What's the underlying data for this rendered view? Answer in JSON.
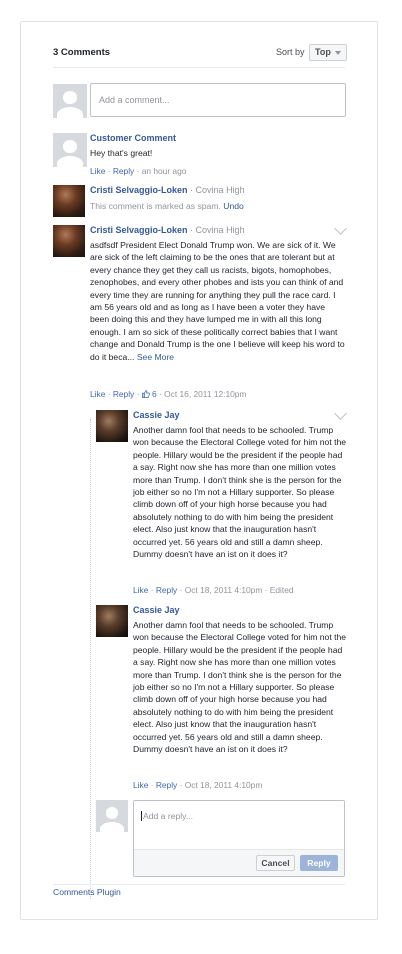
{
  "header": {
    "count_label": "3 Comments",
    "sort_label": "Sort by",
    "sort_value": "Top"
  },
  "composer": {
    "placeholder": "Add a comment..."
  },
  "comments": [
    {
      "author": "Customer Comment",
      "text": "Hey that's great!",
      "like": "Like",
      "reply": "Reply",
      "time": "an hour ago"
    },
    {
      "author": "Cristi Selvaggio-Loken",
      "school": "Covina High",
      "spam_text": "This comment is marked as spam.",
      "undo": "Undo"
    },
    {
      "author": "Cristi Selvaggio-Loken",
      "school": "Covina High",
      "text": "asdfsdf President Elect Donald Trump won. We are sick of it. We are sick of the left claiming to be the ones that are tolerant but at every chance they get they call us racists, bigots, homophobes, zenophobes, and every other phobes and ists you can think of and every time they are running for anything they pull the race card. I am 56 years old and as long as I have been a voter they have been doing this and they have lumped me in with all this long enough. I am so sick of these politically correct babies that I want change and Donald Trump is the one I believe will keep his word to do it beca...",
      "see_more": "See More",
      "like": "Like",
      "reply": "Reply",
      "likes": "6",
      "time": "Oct 16, 2011 12:10pm"
    }
  ],
  "replies": [
    {
      "author": "Cassie Jay",
      "text": "Another damn fool that needs to be schooled. Trump won because the Electoral College voted for him not the people. Hillary would be the president if the people had a say. Right now she has more than one million votes more than Trump. I don't think she is the person for the job either so no I'm not a Hillary supporter. So please climb down off of your high horse because you had absolutely nothing to do with him being the president elect. Also just know that the inauguration hasn't occurred yet. 56 years old and still a damn sheep. Dummy doesn't have an ist on it does it?",
      "like": "Like",
      "reply": "Reply",
      "time": "Oct 18, 2011 4:10pm",
      "edited": "Edited"
    },
    {
      "author": "Cassie Jay",
      "text": "Another damn fool that needs to be schooled. Trump won because the Electoral College voted for him not the people. Hillary would be the president if the people had a say. Right now she has more than one million votes more than Trump. I don't think she is the person for the job either so no I'm not a Hillary supporter. So please climb down off of your high horse because you had absolutely nothing to do with him being the president elect. Also just know that the inauguration hasn't occurred yet. 56 years old and still a damn sheep. Dummy doesn't have an ist on it does it?",
      "like": "Like",
      "reply": "Reply",
      "time": "Oct 18, 2011 4:10pm"
    }
  ],
  "reply_composer": {
    "placeholder": "Add a reply...",
    "cancel": "Cancel",
    "submit": "Reply"
  },
  "footer": {
    "plugin_label": "Comments Plugin"
  },
  "colors": {
    "link": "#365899",
    "meta": "#90949c",
    "reply_button": "#9cb4d8"
  }
}
